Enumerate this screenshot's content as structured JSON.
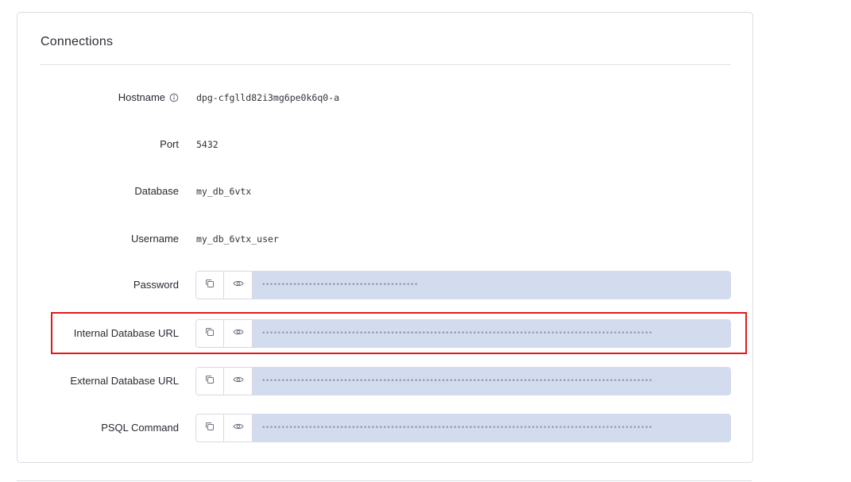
{
  "connections": {
    "title": "Connections",
    "hostname": {
      "label": "Hostname",
      "value": "dpg-cfglld82i3mg6pe0k6q0-a"
    },
    "port": {
      "label": "Port",
      "value": "5432"
    },
    "database": {
      "label": "Database",
      "value": "my_db_6vtx"
    },
    "username": {
      "label": "Username",
      "value": "my_db_6vtx_user"
    },
    "password": {
      "label": "Password",
      "masked": "••••••••••••••••••••••••••••••••••••••••"
    },
    "internal_url": {
      "label": "Internal Database URL",
      "masked": "••••••••••••••••••••••••••••••••••••••••••••••••••••••••••••••••••••••••••••••••••••••••••••••••••••"
    },
    "external_url": {
      "label": "External Database URL",
      "masked": "••••••••••••••••••••••••••••••••••••••••••••••••••••••••••••••••••••••••••••••••••••••••••••••••••••"
    },
    "psql_command": {
      "label": "PSQL Command",
      "masked": "••••••••••••••••••••••••••••••••••••••••••••••••••••••••••••••••••••••••••••••••••••••••••••••••••••"
    }
  },
  "icons": {
    "info": "info-circle-icon",
    "copy": "copy-icon",
    "reveal": "eye-icon"
  },
  "colors": {
    "secret_field_bg": "#d2dcee",
    "highlight": "#e0191e"
  }
}
